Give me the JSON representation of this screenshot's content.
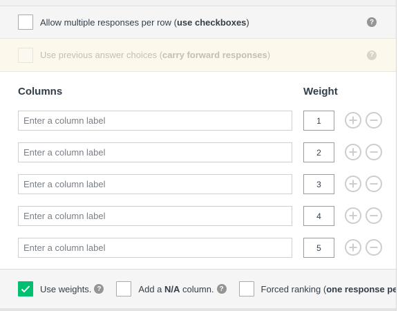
{
  "options": {
    "multiple_responses": {
      "label_pre": "Allow multiple responses per row (",
      "label_bold": "use checkboxes",
      "label_post": ")",
      "checked": false
    },
    "previous_choices": {
      "label_pre": "Use previous answer choices (",
      "label_bold": "carry forward responses",
      "label_post": ")",
      "disabled": true
    },
    "help_glyph": "?"
  },
  "columns": {
    "header_columns": "Columns",
    "header_weight": "Weight",
    "placeholder": "Enter a column label",
    "rows": [
      {
        "label": "",
        "weight": "1"
      },
      {
        "label": "",
        "weight": "2"
      },
      {
        "label": "",
        "weight": "3"
      },
      {
        "label": "",
        "weight": "4"
      },
      {
        "label": "",
        "weight": "5"
      }
    ]
  },
  "bottom_options": {
    "use_weights": {
      "label": "Use weights.",
      "checked": true
    },
    "na_column": {
      "label_pre": "Add a ",
      "label_bold": "N/A",
      "label_post": " column.",
      "checked": false
    },
    "forced_ranking": {
      "label_pre": "Forced ranking (",
      "label_bold": "one response per",
      "checked": false
    }
  },
  "colors": {
    "accent_green": "#00bf6f",
    "disabled_row_bg": "#fcf8ec",
    "icon_gray": "#c8c8c8"
  }
}
